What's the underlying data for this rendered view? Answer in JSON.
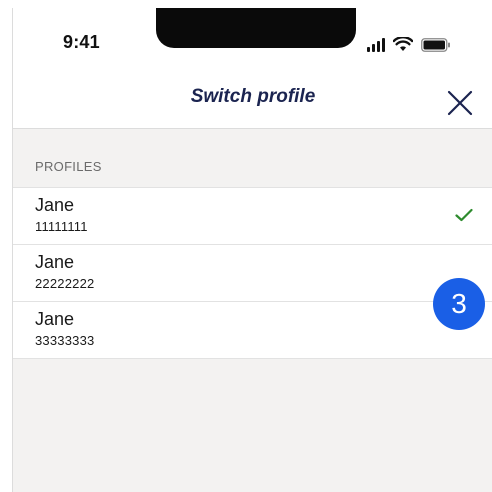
{
  "status_bar": {
    "time": "9:41"
  },
  "nav": {
    "title": "Switch profile",
    "close_icon": "close-icon"
  },
  "section": {
    "label": "PROFILES"
  },
  "profiles": [
    {
      "name": "Jane",
      "number": "11111111",
      "selected": true
    },
    {
      "name": "Jane",
      "number": "22222222",
      "selected": false
    },
    {
      "name": "Jane",
      "number": "33333333",
      "selected": false
    }
  ],
  "badge": {
    "label": "3"
  },
  "colors": {
    "title": "#1b2450",
    "check": "#2e8b2e",
    "badge": "#1a5fe6",
    "background": "#f3f2f1"
  }
}
